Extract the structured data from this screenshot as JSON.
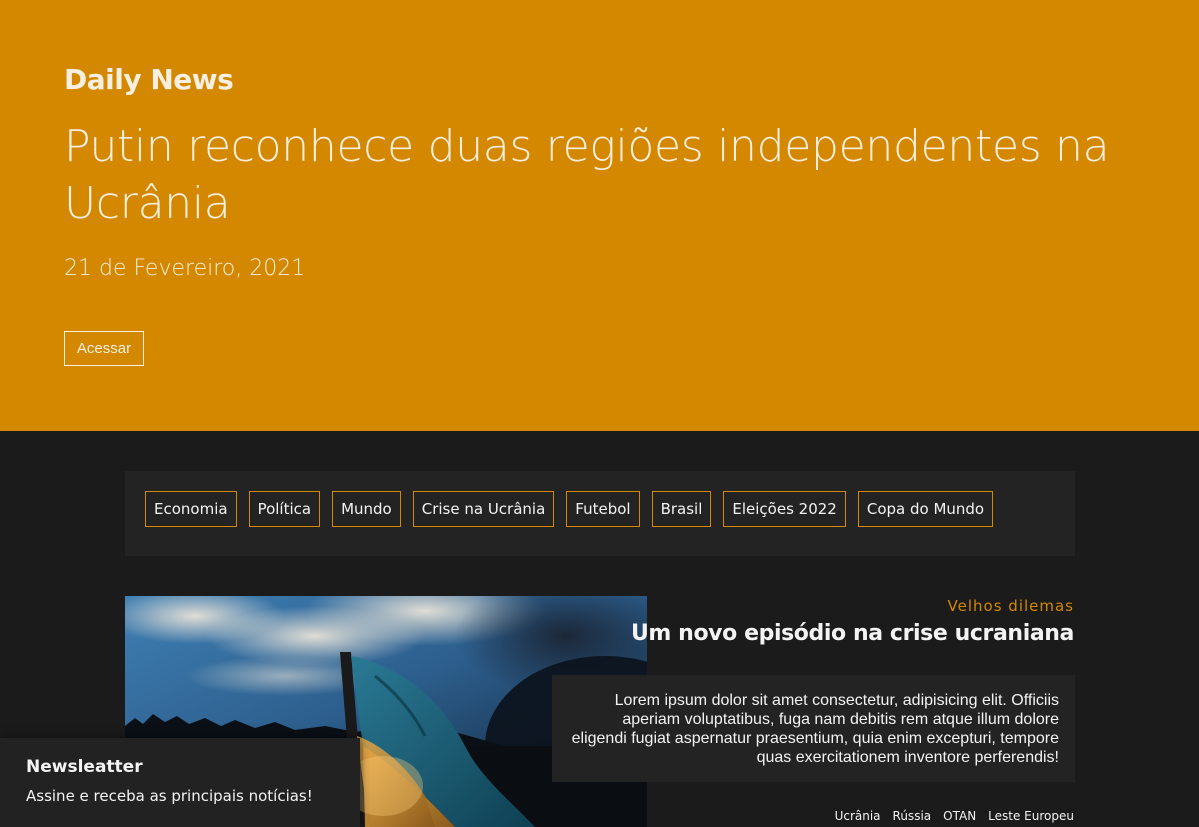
{
  "hero": {
    "brand": "Daily News",
    "headline": "Putin reconhece duas regiões independentes na Ucrânia",
    "date": "21 de Fevereiro, 2021",
    "access_button": "Acessar"
  },
  "categories": [
    "Economia",
    "Política",
    "Mundo",
    "Crise na Ucrânia",
    "Futebol",
    "Brasil",
    "Eleições 2022",
    "Copa do Mundo"
  ],
  "article": {
    "kicker": "Velhos dilemas",
    "title": "Um novo episódio na crise ucraniana",
    "excerpt": "Lorem ipsum dolor sit amet consectetur, adipisicing elit. Officiis aperiam voluptatibus, fuga nam debitis rem atque illum dolore eligendi fugiat aspernatur praesentium, quia enim excepturi, tempore quas exercitationem inventore perferendis!",
    "tags": [
      "Ucrânia",
      "Rússia",
      "OTAN",
      "Leste Europeu"
    ]
  },
  "newsletter": {
    "title": "Newsleatter",
    "text": "Assine e receba as principais notícias!"
  },
  "colors": {
    "accent": "#d48800",
    "background": "#1b1b1c",
    "panel": "#232324"
  }
}
